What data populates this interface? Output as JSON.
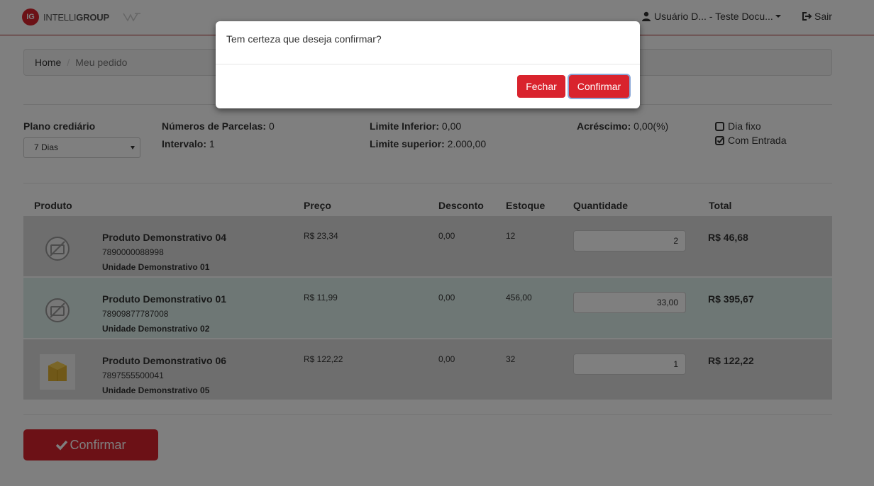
{
  "nav": {
    "logo_initials": "IG",
    "logo_text_light": "INTELLI",
    "logo_text_bold": "GROUP",
    "user_label": "Usuário D... - Teste Docu...",
    "exit_label": "Sair"
  },
  "breadcrumb": {
    "home": "Home",
    "current": "Meu pedido"
  },
  "plan": {
    "label": "Plano crediário",
    "selected": "7 Dias",
    "parcelas_label": "Números de Parcelas:",
    "parcelas_value": " 0",
    "intervalo_label": "Intervalo:",
    "intervalo_value": " 1",
    "limite_inf_label": "Limite Inferior:",
    "limite_inf_value": " 0,00",
    "limite_sup_label": "Limite superior:",
    "limite_sup_value": " 2.000,00",
    "acrescimo_label": "Acréscimo:",
    "acrescimo_value": " 0,00(%)",
    "dia_fixo_label": "Dia fixo",
    "com_entrada_label": "Com Entrada",
    "dia_fixo_checked": false,
    "com_entrada_checked": true
  },
  "table": {
    "headers": {
      "produto": "Produto",
      "preco": "Preço",
      "desconto": "Desconto",
      "estoque": "Estoque",
      "quantidade": "Quantidade",
      "total": "Total"
    },
    "rows": [
      {
        "name": "Produto Demonstrativo 04",
        "code": "7890000088998",
        "unit": "Unidade Demonstrativo 01",
        "price": "R$ 23,34",
        "discount": "0,00",
        "stock": "12",
        "qty": "2",
        "total": "R$ 46,68"
      },
      {
        "name": "Produto Demonstrativo 01",
        "code": "78909877787008",
        "unit": "Unidade Demonstrativo 02",
        "price": "R$ 11,99",
        "discount": "0,00",
        "stock": "456,00",
        "qty": "33,00",
        "total": "R$ 395,67"
      },
      {
        "name": "Produto Demonstrativo 06",
        "code": "7897555500041",
        "unit": "Unidade Demonstrativo 05",
        "price": "R$ 122,22",
        "discount": "0,00",
        "stock": "32",
        "qty": "1",
        "total": "R$ 122,22"
      }
    ]
  },
  "confirm_button": "Confirmar",
  "modal": {
    "message": "Tem certeza que deseja confirmar?",
    "close_label": "Fechar",
    "confirm_label": "Confirmar"
  },
  "colors": {
    "brand_red": "#d9232d",
    "row_highlight": "#dcefea",
    "row_gray": "#dddddd"
  }
}
